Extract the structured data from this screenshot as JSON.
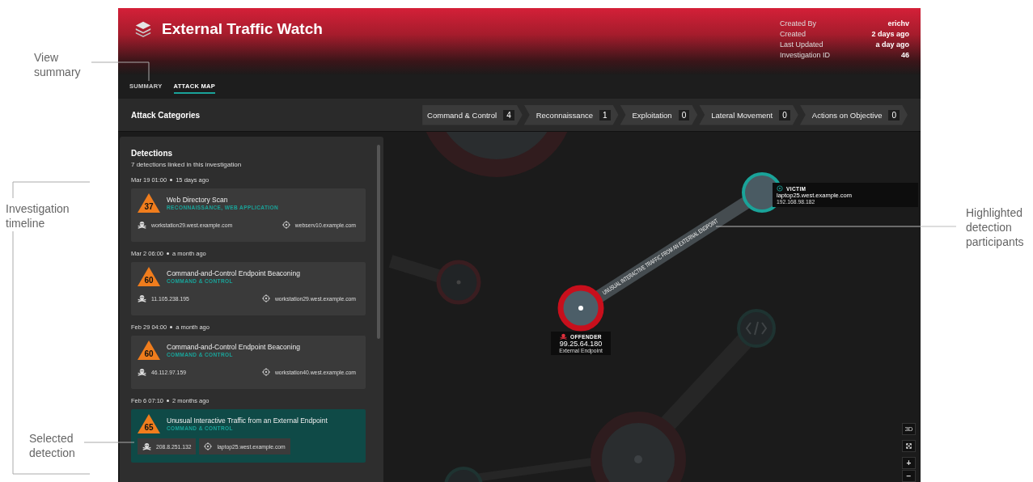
{
  "header": {
    "title": "External Traffic Watch",
    "meta": [
      {
        "label": "Created By",
        "value": "erichv"
      },
      {
        "label": "Created",
        "value": "2 days ago"
      },
      {
        "label": "Last Updated",
        "value": "a day ago"
      },
      {
        "label": "Investigation ID",
        "value": "46"
      }
    ]
  },
  "tabs": [
    {
      "label": "SUMMARY",
      "selected": false
    },
    {
      "label": "ATTACK MAP",
      "selected": true
    }
  ],
  "categories": {
    "title": "Attack Categories",
    "items": [
      {
        "label": "Command & Control",
        "count": "4"
      },
      {
        "label": "Reconnaissance",
        "count": "1"
      },
      {
        "label": "Exploitation",
        "count": "0"
      },
      {
        "label": "Lateral Movement",
        "count": "0"
      },
      {
        "label": "Actions on Objective",
        "count": "0"
      }
    ]
  },
  "detections": {
    "title": "Detections",
    "subtitle": "7 detections linked in this investigation",
    "items": [
      {
        "date": "Mar 19 01:00",
        "ago": "15 days ago",
        "score": "37",
        "name": "Web Directory Scan",
        "category": "RECONNAISSANCE, WEB APPLICATION",
        "offender": "workstation29.west.example.com",
        "victim": "webserv10.example.com",
        "selected": false
      },
      {
        "date": "Mar 2 06:00",
        "ago": "a month ago",
        "score": "60",
        "name": "Command-and-Control Endpoint Beaconing",
        "category": "COMMAND & CONTROL",
        "offender": "11.105.238.195",
        "victim": "workstation29.west.example.com",
        "selected": false
      },
      {
        "date": "Feb 29 04:00",
        "ago": "a month ago",
        "score": "60",
        "name": "Command-and-Control Endpoint Beaconing",
        "category": "COMMAND & CONTROL",
        "offender": "46.112.97.159",
        "victim": "workstation40.west.example.com",
        "selected": false
      },
      {
        "date": "Feb 6 07:10",
        "ago": "2 months ago",
        "score": "65",
        "name": "Unusual Interactive Traffic from an External Endpoint",
        "category": "COMMAND & CONTROL",
        "offender": "208.8.251.132",
        "victim": "laptop25.west.example.com",
        "selected": true
      }
    ]
  },
  "map": {
    "edge_label": "UNUSUAL INTERACTIVE TRAFFIC FROM AN EXTERNAL ENDPOINT",
    "offender": {
      "role": "OFFENDER",
      "address": "99.25.64.180",
      "type": "External Endpoint"
    },
    "victim": {
      "role": "VICTIM",
      "host": "laptop25.west.example.com",
      "address": "192.168.98.182"
    },
    "controls": {
      "view": "3D",
      "zoom_in": "+",
      "zoom_out": "−"
    }
  },
  "callouts": [
    "View summary",
    "Investigation timeline",
    "Selected detection",
    "Highlighted detection participants"
  ]
}
